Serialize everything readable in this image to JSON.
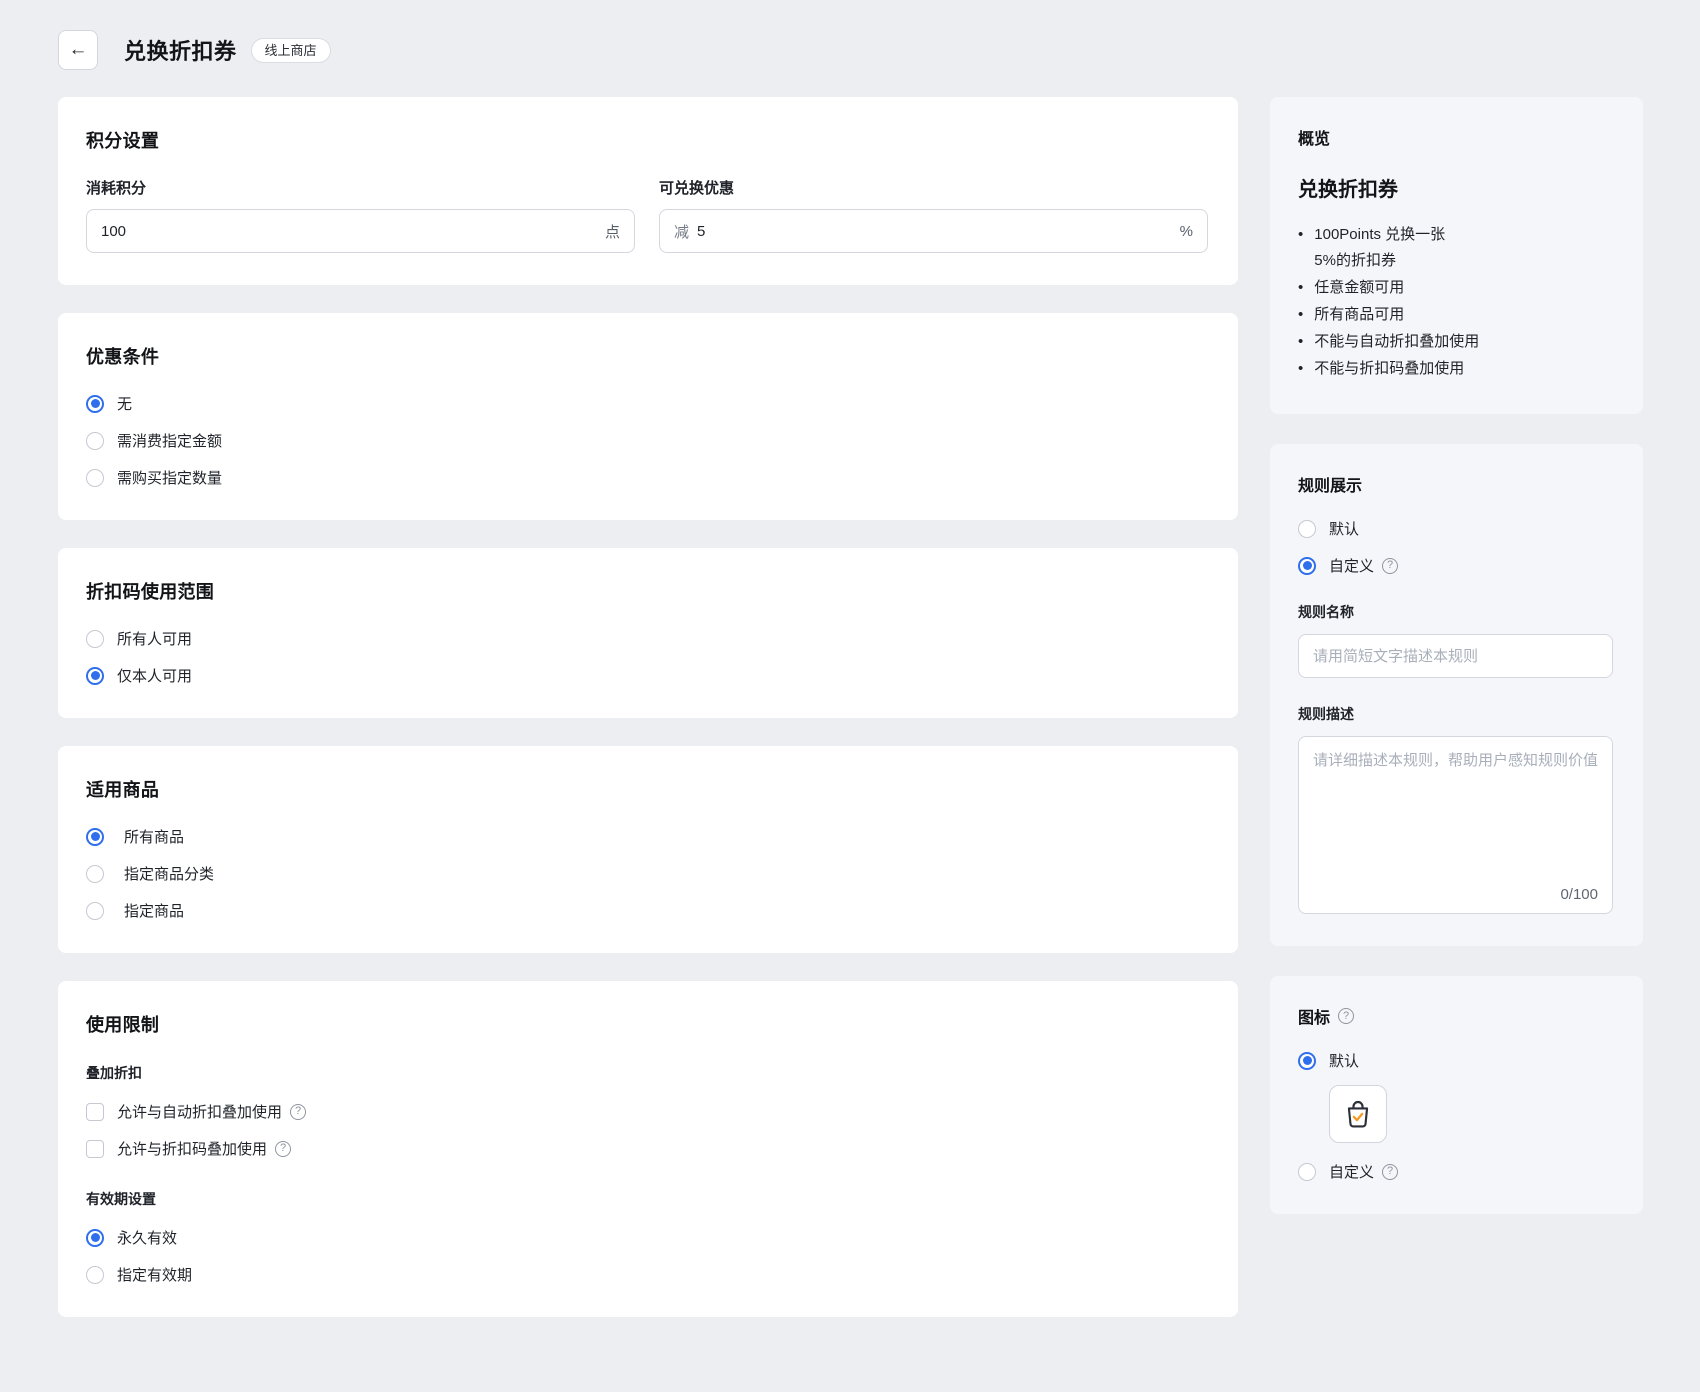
{
  "header": {
    "back_icon": "←",
    "title": "兑换折扣券",
    "badge": "线上商店"
  },
  "icons": {
    "help": "?",
    "bullet": "•"
  },
  "colors": {
    "accent": "#2f6fed",
    "bag_check": "#f59a23"
  },
  "points_card": {
    "title": "积分设置",
    "fields": [
      {
        "label": "消耗积分",
        "value": "100",
        "suffix": "点"
      },
      {
        "label": "可兑换优惠",
        "prefix": "减",
        "value": "5",
        "suffix": "%"
      }
    ]
  },
  "condition_card": {
    "title": "优惠条件",
    "options": [
      {
        "label": "无",
        "selected": true
      },
      {
        "label": "需消费指定金额",
        "selected": false
      },
      {
        "label": "需购买指定数量",
        "selected": false
      }
    ]
  },
  "scope_card": {
    "title": "折扣码使用范围",
    "options": [
      {
        "label": "所有人可用",
        "selected": false
      },
      {
        "label": "仅本人可用",
        "selected": true
      }
    ]
  },
  "products_card": {
    "title": "适用商品",
    "options": [
      {
        "label": "所有商品",
        "selected": true
      },
      {
        "label": "指定商品分类",
        "selected": false
      },
      {
        "label": "指定商品",
        "selected": false
      }
    ]
  },
  "limits_card": {
    "title": "使用限制",
    "stack_section": {
      "label": "叠加折扣",
      "checkboxes": [
        {
          "label": "允许与自动折扣叠加使用",
          "checked": false
        },
        {
          "label": "允许与折扣码叠加使用",
          "checked": false
        }
      ]
    },
    "validity_section": {
      "label": "有效期设置",
      "options": [
        {
          "label": "永久有效",
          "selected": true
        },
        {
          "label": "指定有效期",
          "selected": false
        }
      ]
    }
  },
  "overview_card": {
    "title": "概览",
    "heading": "兑换折扣券",
    "bullets": [
      "100Points 兑换一张\n5%的折扣券",
      "任意金额可用",
      "所有商品可用",
      "不能与自动折扣叠加使用",
      "不能与折扣码叠加使用"
    ]
  },
  "rule_card": {
    "title": "规则展示",
    "options": [
      {
        "label": "默认",
        "selected": false
      },
      {
        "label": "自定义",
        "selected": true
      }
    ],
    "name_label": "规则名称",
    "name_placeholder": "请用简短文字描述本规则",
    "desc_label": "规则描述",
    "desc_placeholder": "请详细描述本规则，帮助用户感知规则价值",
    "counter": "0/100"
  },
  "icon_card": {
    "title": "图标",
    "options": [
      {
        "label": "默认",
        "selected": true
      },
      {
        "label": "自定义",
        "selected": false
      }
    ]
  }
}
